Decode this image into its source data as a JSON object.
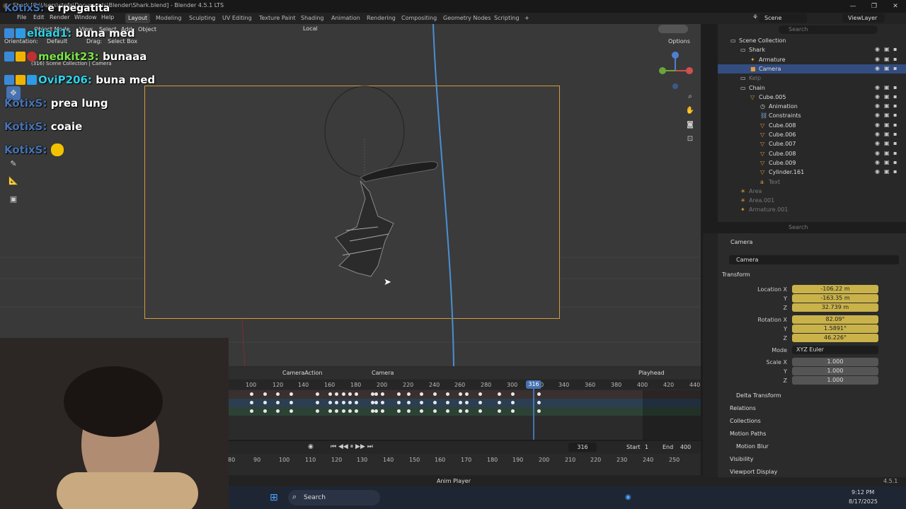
{
  "window": {
    "title": "Shark [C:\\Users\\stefa\\Documents\\Blender\\Shark.blend] - Blender 4.5.1 LTS",
    "minimize": "—",
    "maximize": "❐",
    "close": "✕"
  },
  "menu": [
    "File",
    "Edit",
    "Render",
    "Window",
    "Help"
  ],
  "workspaces": [
    "Layout",
    "Modeling",
    "Sculpting",
    "UV Editing",
    "Texture Paint",
    "Shading",
    "Animation",
    "Rendering",
    "Compositing",
    "Geometry Nodes",
    "Scripting"
  ],
  "active_workspace": "Layout",
  "scene": {
    "name": "Scene",
    "view_layer": "ViewLayer"
  },
  "viewport": {
    "mode": "Object Mode",
    "menus": [
      "View",
      "Select",
      "Add",
      "Object"
    ],
    "orientation_label": "Orientation:",
    "orientation": "Default",
    "drag_label": "Drag:",
    "drag": "Select Box",
    "pivot": "Local",
    "info": "(316) Scene Collection | Camera",
    "options": "Options"
  },
  "chat": [
    {
      "user": "KotixS:",
      "msg": "e rpegatita"
    },
    {
      "user": "eldad1:",
      "msg": "buna med"
    },
    {
      "user": "medkit23:",
      "msg": "bunaaa"
    },
    {
      "user": "OviP206:",
      "msg": "buna med"
    },
    {
      "user": "KotixS:",
      "msg": "prea lung"
    },
    {
      "user": "KotixS:",
      "msg": "coaie"
    },
    {
      "user": "KotixS:",
      "msg": ""
    }
  ],
  "colors": {
    "accent": "#4772b3",
    "camera_frame": "#d69a3a",
    "field_yellow": "#c9b24a",
    "selected_row": "#334d80",
    "playhead": "#4772b3"
  },
  "timeline": {
    "action": "CameraAction",
    "object": "Camera",
    "playhead_label": "Playhead",
    "ruler_ticks": [
      "100",
      "120",
      "140",
      "160",
      "180",
      "200",
      "220",
      "240",
      "260",
      "280",
      "300",
      "320",
      "340",
      "360",
      "380",
      "400",
      "420",
      "440"
    ],
    "current_frame": "316",
    "current_frame_marker": "316",
    "start_label": "Start",
    "start": "1",
    "end_label": "End",
    "end": "400",
    "lower_ticks": [
      "80",
      "90",
      "100",
      "110",
      "120",
      "130",
      "140",
      "150",
      "160",
      "170",
      "180",
      "190",
      "200",
      "210",
      "220",
      "230",
      "240",
      "250"
    ]
  },
  "outliner": {
    "search_placeholder": "Search",
    "rows": [
      {
        "label": "Scene Collection",
        "indent": 0,
        "icon": "collection-icon"
      },
      {
        "label": "Shark",
        "indent": 1,
        "icon": "collection-icon"
      },
      {
        "label": "Armature",
        "indent": 2,
        "icon": "armature-icon"
      },
      {
        "label": "Camera",
        "indent": 2,
        "icon": "camera-icon",
        "selected": true
      },
      {
        "label": "Kelp",
        "indent": 1,
        "icon": "collection-icon",
        "dim": true
      },
      {
        "label": "Chain",
        "indent": 1,
        "icon": "collection-icon"
      },
      {
        "label": "Cube.005",
        "indent": 2,
        "icon": "mesh-icon"
      },
      {
        "label": "Animation",
        "indent": 3,
        "icon": "animation-icon"
      },
      {
        "label": "Constraints",
        "indent": 3,
        "icon": "constraint-icon"
      },
      {
        "label": "Cube.008",
        "indent": 3,
        "icon": "mesh-icon"
      },
      {
        "label": "Cube.006",
        "indent": 3,
        "icon": "mesh-icon"
      },
      {
        "label": "Cube.007",
        "indent": 3,
        "icon": "mesh-icon"
      },
      {
        "label": "Cube.008",
        "indent": 3,
        "icon": "mesh-icon"
      },
      {
        "label": "Cube.009",
        "indent": 3,
        "icon": "mesh-icon"
      },
      {
        "label": "Cylinder.161",
        "indent": 3,
        "icon": "mesh-icon"
      },
      {
        "label": "Text",
        "indent": 3,
        "icon": "text-icon",
        "dim": true
      },
      {
        "label": "Area",
        "indent": 1,
        "icon": "light-icon",
        "dim": true
      },
      {
        "label": "Area.001",
        "indent": 1,
        "icon": "light-icon",
        "dim": true
      },
      {
        "label": "Armature.001",
        "indent": 1,
        "icon": "armature-icon",
        "dim": true
      }
    ]
  },
  "properties": {
    "search_placeholder": "Search",
    "breadcrumb": "Camera",
    "object_name": "Camera",
    "transform": "Transform",
    "location_label": "Location X",
    "location": [
      "-106.22 m",
      "-163.35 m",
      "32.739 m"
    ],
    "rotation_label": "Rotation X",
    "rotation": [
      "82.09°",
      "1.5891°",
      "46.226°"
    ],
    "axis_y": "Y",
    "axis_z": "Z",
    "mode_label": "Mode",
    "mode": "XYZ Euler",
    "scale_label": "Scale X",
    "scale": [
      "1.000",
      "1.000",
      "1.000"
    ],
    "delta_transform": "Delta Transform",
    "sections": [
      "Relations",
      "Collections",
      "Motion Paths",
      "Motion Blur",
      "Visibility",
      "Viewport Display"
    ]
  },
  "status": {
    "anim_player": "Anim Player",
    "version": "4.5.1"
  },
  "taskbar": {
    "search": "Search",
    "time": "9:12 PM",
    "date": "8/17/2025"
  }
}
